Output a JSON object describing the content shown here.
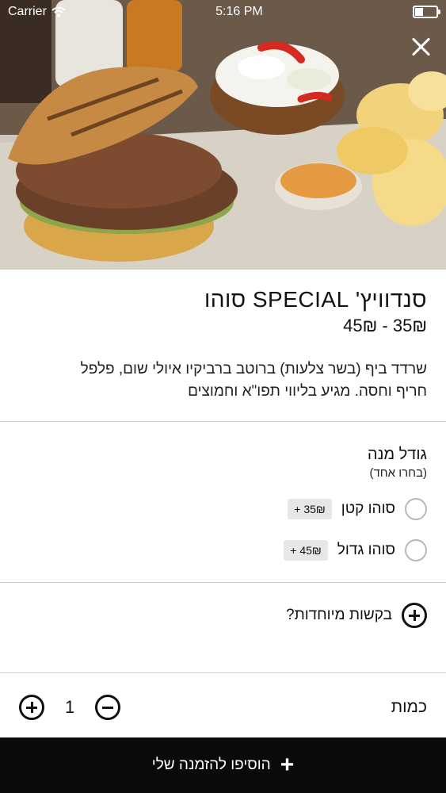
{
  "status_bar": {
    "carrier": "Carrier",
    "time": "5:16 PM"
  },
  "item": {
    "title": "סנדוויץ' SPECIAL סוהו",
    "price_range": "35₪ - 45₪",
    "description": "שרדד ביף (בשר צלעות) ברוטב ברביקיו איולי שום, פלפל חריף וחסה. מגיע בליווי תפו\"א וחמוצים"
  },
  "portion": {
    "title": "גודל מנה",
    "subtitle": "(בחרו אחד)",
    "options": [
      {
        "label": "סוהו קטן",
        "price": "+ 35₪",
        "selected": false
      },
      {
        "label": "סוהו גדול",
        "price": "+ 45₪",
        "selected": false
      }
    ]
  },
  "special_requests": {
    "label": "בקשות מיוחדות?"
  },
  "quantity": {
    "label": "כמות",
    "value": "1"
  },
  "add_to_order": {
    "label": "הוסיפו להזמנה שלי"
  },
  "colors": {
    "bottom_bar": "#0a0a0a",
    "radio_border": "#b8b8b8",
    "badge_bg": "#e7e7e7"
  }
}
